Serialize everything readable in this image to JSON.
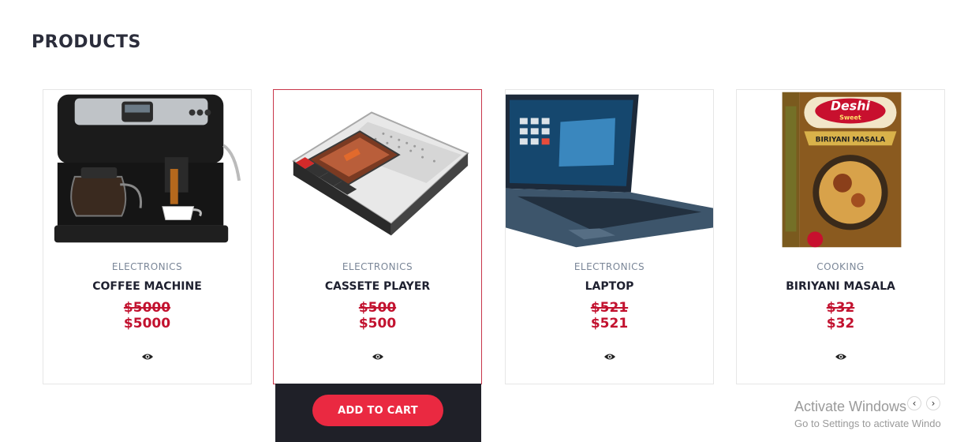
{
  "section": {
    "title": "PRODUCTS"
  },
  "products": [
    {
      "category": "ELECTRONICS",
      "name": "COFFEE MACHINE",
      "old_price": "$5000",
      "price": "$5000",
      "image_icon": "coffee-machine"
    },
    {
      "category": "ELECTRONICS",
      "name": "CASSETE PLAYER",
      "old_price": "$500",
      "price": "$500",
      "image_icon": "cassette-player"
    },
    {
      "category": "ELECTRONICS",
      "name": "LAPTOP",
      "old_price": "$521",
      "price": "$521",
      "image_icon": "laptop"
    },
    {
      "category": "COOKING",
      "name": "BIRIYANI MASALA",
      "old_price": "$32",
      "price": "$32",
      "image_icon": "spice-box",
      "packaging": {
        "brand": "Deshi",
        "brand_sub": "Sweet",
        "label": "BIRIYANI MASALA"
      }
    }
  ],
  "cart": {
    "label": "ADD TO CART"
  },
  "carousel": {
    "prev_icon": "chevron-left-icon",
    "next_icon": "chevron-right-icon"
  },
  "watermark": {
    "title": "Activate Windows",
    "subtitle": "Go to Settings to activate Windo"
  },
  "colors": {
    "accent": "#ea2941",
    "price": "#c2122f",
    "dark_panel": "#1f2028",
    "active_border": "#c8364a"
  }
}
